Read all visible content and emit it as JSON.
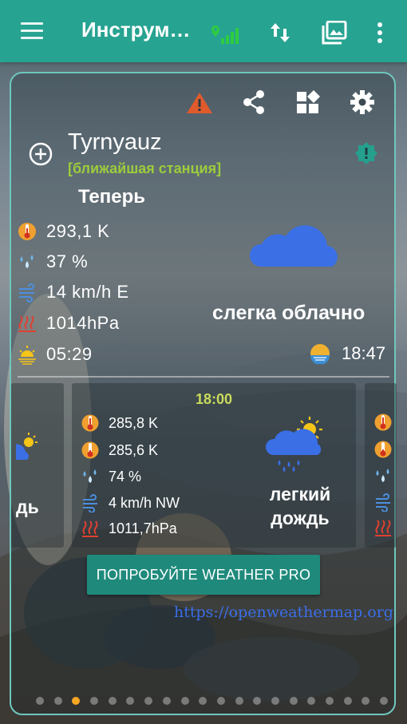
{
  "appbar": {
    "title": "Инструм…",
    "menu_icon": "hamburger-menu-icon",
    "signal_icon": "location-signal-icon",
    "io_icon": "up-down-arrows-icon",
    "gallery_icon": "image-gallery-icon",
    "more_icon": "more-vert-icon",
    "color": "#27a391"
  },
  "toolbar": {
    "alert_icon": "warning-icon",
    "share_icon": "share-icon",
    "widgets_icon": "widgets-icon",
    "settings_icon": "gear-icon",
    "alert_color": "#e05a2b"
  },
  "location": {
    "city": "Tyrnyauz",
    "station": "[ближайшая станция]",
    "add_icon": "add-circle-icon",
    "badge_icon": "alert-badge-icon"
  },
  "current": {
    "heading": "Теперь",
    "temperature": "293,1 K",
    "humidity": "37 %",
    "wind": "14 km/h E",
    "pressure": "1014hPa",
    "sunrise": "05:29",
    "sunset": "18:47",
    "condition": "слегка облачно",
    "condition_icon": "cloud-icon"
  },
  "forecast": {
    "main": {
      "time": "18:00",
      "temp_max": "285,8 K",
      "temp_min": "285,6 K",
      "humidity": "74 %",
      "wind": "4 km/h NW",
      "pressure": "1011,7hPa",
      "condition_line1": "легкий",
      "condition_line2": "дождь",
      "condition_icon": "sun-rain-cloud-icon"
    },
    "left_partial_condition": "дь"
  },
  "promo": {
    "button_label": "ПОПРОБУЙТЕ WEATHER PRO",
    "link": "https://openweathermap.org"
  },
  "pager": {
    "count": 20,
    "active_index": 2
  }
}
